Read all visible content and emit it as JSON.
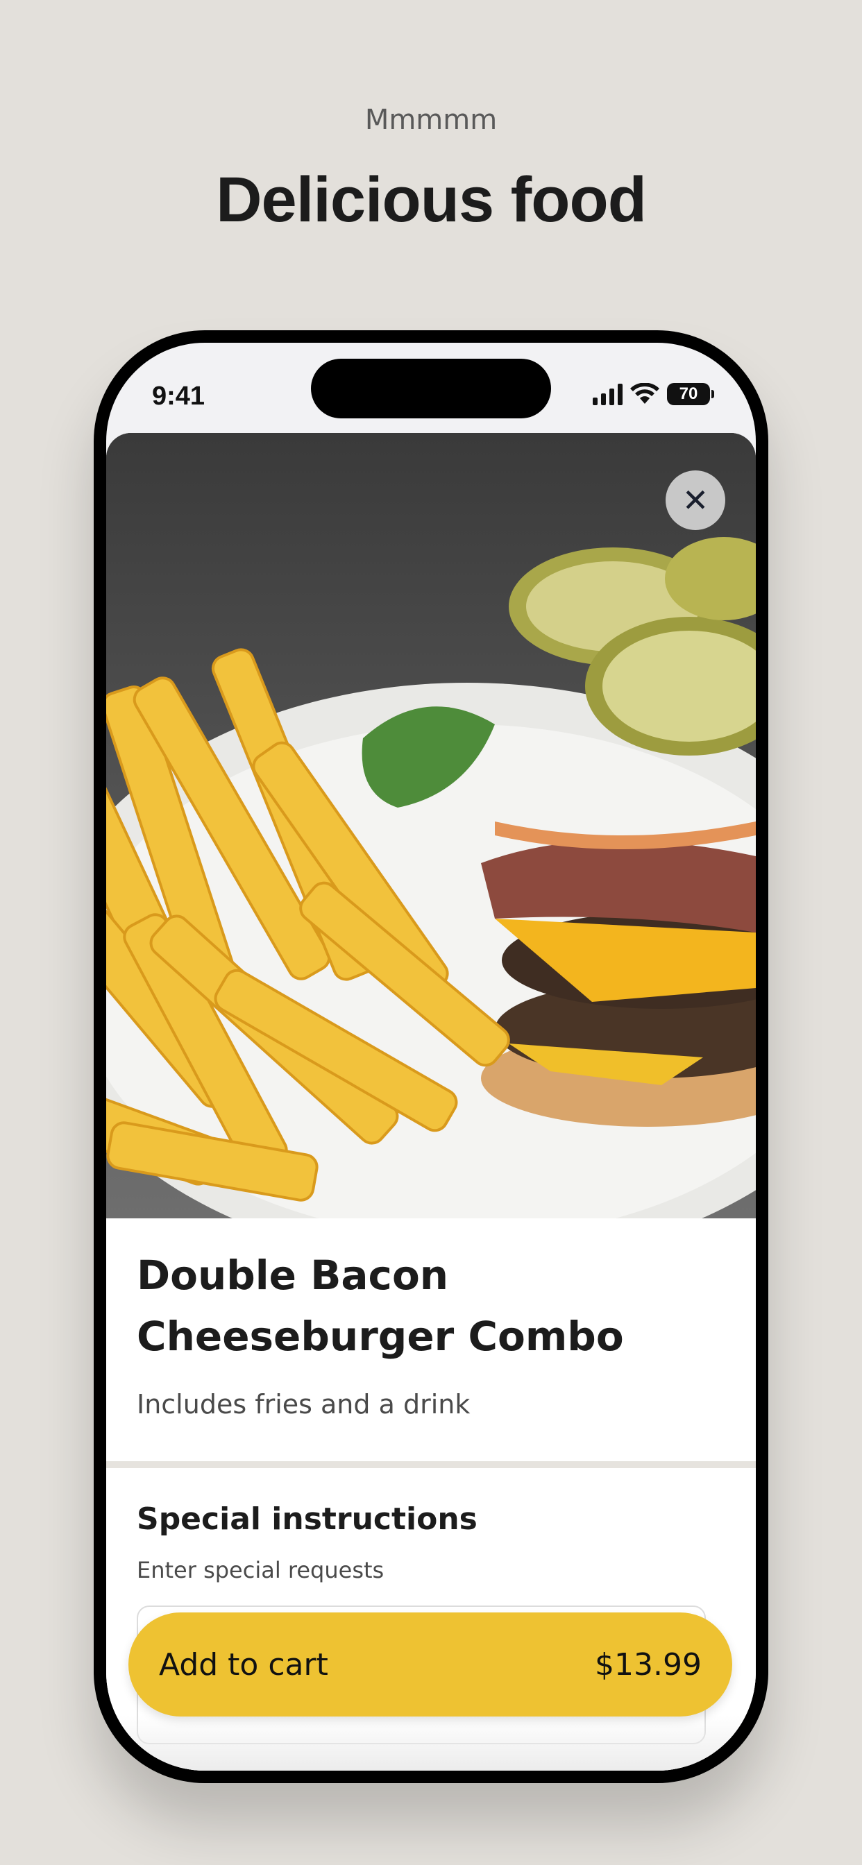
{
  "header": {
    "eyebrow": "Mmmmm",
    "headline": "Delicious food"
  },
  "status_bar": {
    "time": "9:41",
    "battery": "70",
    "icons": [
      "signal-icon",
      "wifi-icon",
      "battery-icon"
    ]
  },
  "item": {
    "image_alt": "Double bacon cheeseburger with fries",
    "title": "Double Bacon Cheeseburger Combo",
    "description": "Includes fries and a drink",
    "close_icon": "close-icon"
  },
  "special_instructions": {
    "title": "Special instructions",
    "hint": "Enter special requests",
    "value": ""
  },
  "cart_button": {
    "label": "Add to cart",
    "price": "$13.99"
  },
  "colors": {
    "page_background": "#e3e0db",
    "accent": "#eec232",
    "text": "#1c1c1c"
  }
}
